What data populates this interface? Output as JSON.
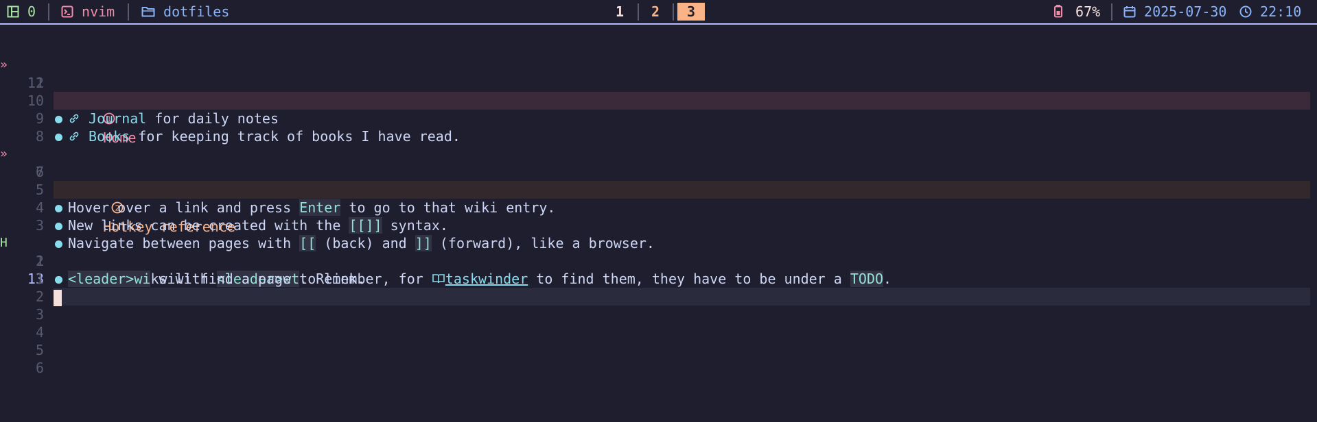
{
  "statusbar": {
    "session_num": "0",
    "window_name": "nvim",
    "directory": "dotfiles",
    "tabs": [
      "1",
      "2",
      "3"
    ],
    "battery": "67%",
    "date": "2025-07-30",
    "time": "22:10"
  },
  "buffer": {
    "lines": [
      {
        "rel": "12",
        "sign": "»",
        "heading": "Home"
      },
      {
        "rel": "11"
      },
      {
        "rel": "10",
        "link": "Journal",
        "text": " for daily notes"
      },
      {
        "rel": "9",
        "link": "Books",
        "text": " for keeping track of books I have read."
      },
      {
        "rel": "8"
      },
      {
        "rel": "7",
        "sign": "»",
        "heading": "Hotkey reference"
      },
      {
        "rel": "6"
      },
      {
        "rel": "5",
        "t1": "Hover over a link and press ",
        "c1": "Enter",
        "t2": " to go to that wiki entry."
      },
      {
        "rel": "4",
        "t1": "New links can be created with the ",
        "c1": "[[]]",
        "t2": " syntax."
      },
      {
        "rel": "3",
        "t1": "Navigate between pages with ",
        "c1": "[[",
        "t2": " (back) and ",
        "c2": "]]",
        "t3": " (forward), like a browser."
      },
      {
        "rel": "2",
        "sign": "H",
        "t1": "Toggle tasks with ",
        "c1": "<leader>wt",
        "t2": ". Remember, for ",
        "ulink": "taskwinder",
        "t3": " to find them, they have to be under a ",
        "c2": "TODO",
        "t4": "."
      },
      {
        "rel": "1",
        "c1": "<leader>wi",
        "t2": " will find a page to link."
      },
      {
        "rel": "13"
      },
      {
        "rel": "1"
      },
      {
        "rel": "2"
      },
      {
        "rel": "3"
      },
      {
        "rel": "4"
      },
      {
        "rel": "5"
      },
      {
        "rel": "6"
      }
    ]
  },
  "colors": {
    "background": "#1e1e2e",
    "heading1": "#f38ba8",
    "heading2": "#fab387",
    "link": "#89dceb",
    "active_tab": "#fab387"
  }
}
